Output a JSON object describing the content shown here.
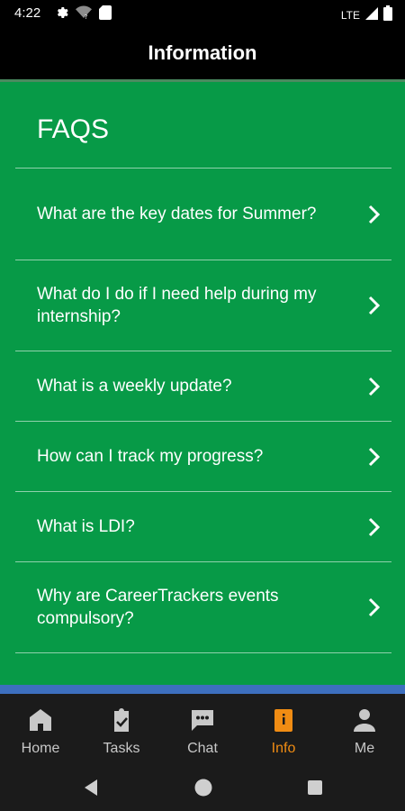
{
  "status_bar": {
    "time": "4:22",
    "network": "LTE"
  },
  "app_bar": {
    "title": "Information"
  },
  "faq": {
    "heading": "FAQS",
    "items": [
      {
        "question": "What are the key dates for Summer?"
      },
      {
        "question": "What do I do if I need help during my internship?"
      },
      {
        "question": "What is a weekly update?"
      },
      {
        "question": "How can I track my progress?"
      },
      {
        "question": "What is LDI?"
      },
      {
        "question": "Why are CareerTrackers events compulsory?"
      }
    ]
  },
  "bottom_nav": {
    "items": [
      {
        "label": "Home",
        "icon": "home-icon"
      },
      {
        "label": "Tasks",
        "icon": "clipboard-icon"
      },
      {
        "label": "Chat",
        "icon": "chat-icon"
      },
      {
        "label": "Info",
        "icon": "info-book-icon",
        "active": true
      },
      {
        "label": "Me",
        "icon": "person-icon"
      }
    ]
  },
  "colors": {
    "background_green": "#079a47",
    "accent_orange": "#f08c13",
    "divider_blue": "#3d6fbf"
  }
}
